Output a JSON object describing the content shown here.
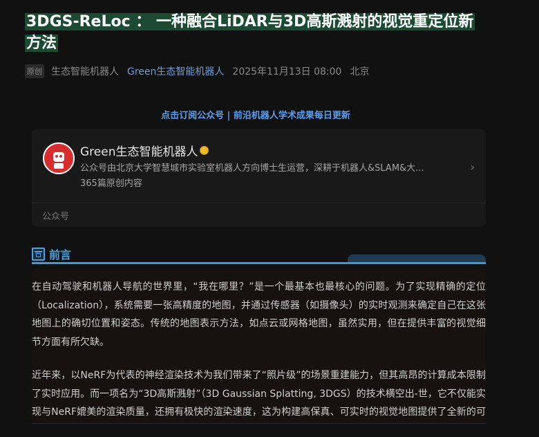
{
  "article": {
    "title": "3DGS-ReLoc ： 一种融合LiDAR与3D高斯溅射的视觉重定位新方法",
    "meta": {
      "badge": "原创",
      "author": "生态智能机器人",
      "account": "Green生态智能机器人",
      "date": "2025年11月13日 08:00",
      "location": "北京"
    },
    "subscribe_text": "点击订阅公众号 | 前沿机器人学术成果每日更新"
  },
  "card": {
    "name": "Green生态智能机器人",
    "description": "公众号由北京大学智慧城市实验室机器人方向博士生运营，深耕于机器人&SLAM&大...",
    "count": "365篇原创内容",
    "footer": "公众号",
    "avatar_icon": "robot-logo-icon",
    "verified_icon": "verified-icon",
    "chevron_icon": "chevron-right-icon"
  },
  "section": {
    "title": "前言",
    "icon": "section-icon",
    "accent_color": "#3e9bd9"
  },
  "paragraphs": [
    "在自动驾驶和机器人导航的世界里，“我在哪里？”是一个最基本也最核心的问题。为了实现精确的定位（Localization），系统需要一张高精度的地图，并通过传感器（如摄像头）的实时观测来确定自己在这张地图上的确切位置和姿态。传统的地图表示方法，如点云或网格地图，虽然实用，但在提供丰富的视觉细节方面有所欠缺。",
    "近年来，以NeRF为代表的神经渲染技术为我们带来了“照片级”的场景重建能力，但其高昂的计算成本限制了实时应用。而一项名为“3D高斯溅射”（3D Gaussian Splatting, 3DGS）的技术横空出-世，它不仅能实现与NeRF媲美的渲染质量，还拥有极快的渲染速度，这为构建高保真、可实时的视觉地图提供了全新的可能性。"
  ]
}
